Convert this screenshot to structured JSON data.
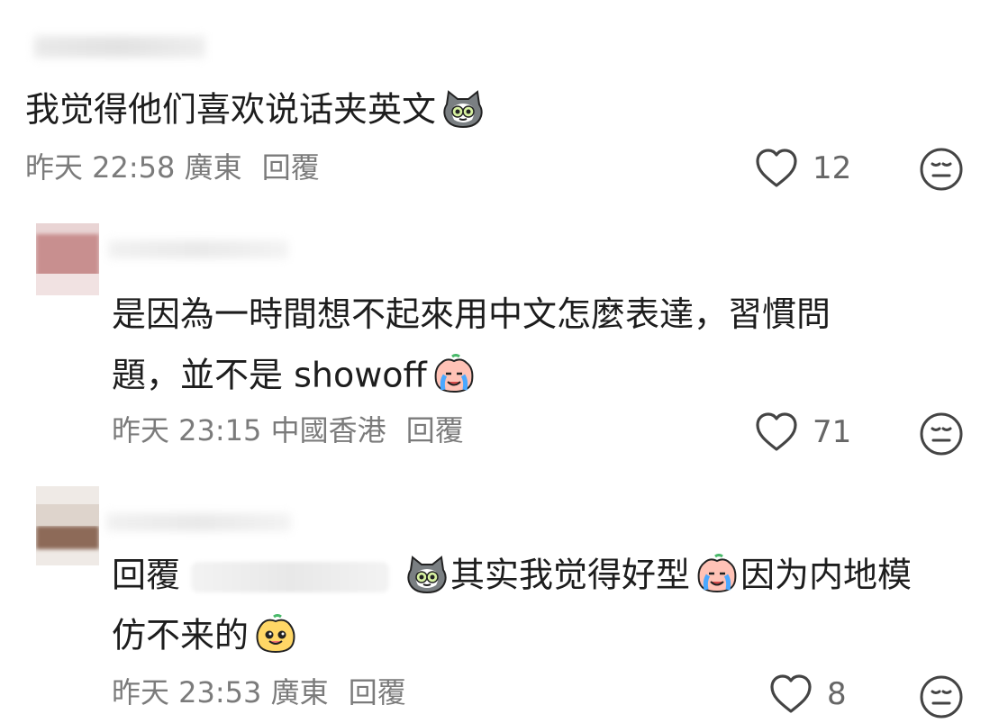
{
  "comments": [
    {
      "text": "我觉得他们喜欢说话夹英文",
      "meta": "昨天 22:58 廣東",
      "reply_label": "回覆",
      "likes": "12",
      "emoji_end": "cat-emoji"
    },
    {
      "line1": "是因為一時間想不起來用中文怎麼表達，習慣問",
      "line2": "題，並不是 showoff",
      "meta": "昨天 23:15 中國香港",
      "reply_label": "回覆",
      "likes": "71",
      "emoji_end": "crying-emoji"
    },
    {
      "reply_prefix": "回覆",
      "line1_after_reply": "其实我觉得好型",
      "line1_after_emoji": "因为内地模",
      "line2": "仿不来的",
      "meta": "昨天 23:53 廣東",
      "reply_label": "回覆",
      "likes": "8",
      "emoji_reply_start": "cat-emoji",
      "emoji_mid": "crying-emoji",
      "emoji_end": "smile-emoji"
    }
  ],
  "colors": {
    "text": "#1d1d1d",
    "meta": "#7b7b7b",
    "heart": "#444444"
  },
  "icons": {
    "like": "heart-icon",
    "dislike": "meh-face-icon"
  }
}
